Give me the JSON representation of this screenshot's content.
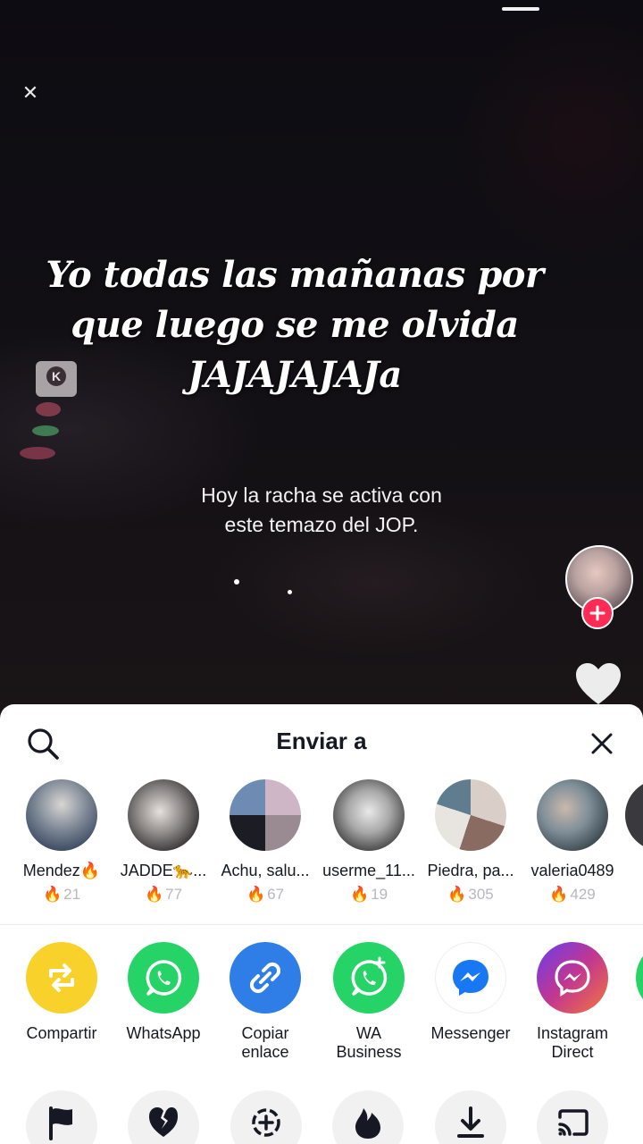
{
  "video": {
    "caption_lines": [
      "Yo todas las mañanas por",
      "que luego se me olvida",
      "JAJAJAJAJa"
    ],
    "subcaption_lines": [
      "Hoy la racha se activa con",
      "este temazo del JOP."
    ]
  },
  "share_sheet": {
    "title": "Enviar a",
    "contacts": [
      {
        "name": "Mendez🔥",
        "streak": "21"
      },
      {
        "name": "JADDE🐆...",
        "streak": "77"
      },
      {
        "name": "Achu, salu...",
        "streak": "67"
      },
      {
        "name": "userme_11...",
        "streak": "19"
      },
      {
        "name": "Piedra, pa...",
        "streak": "305"
      },
      {
        "name": "valeria0489",
        "streak": "429"
      }
    ],
    "apps": [
      {
        "label": "Compartir",
        "icon": "repost-icon",
        "color": "#f8d22a"
      },
      {
        "label": "WhatsApp",
        "icon": "whatsapp-icon",
        "color": "#25d366"
      },
      {
        "label": "Copiar\nenlace",
        "icon": "link-icon",
        "color": "#2f7ee8"
      },
      {
        "label": "WA\nBusiness",
        "icon": "whatsapp-business-icon",
        "color": "#25d366"
      },
      {
        "label": "Messenger",
        "icon": "messenger-icon",
        "color": "#ffffff"
      },
      {
        "label": "Instagram\nDirect",
        "icon": "instagram-direct-icon",
        "color": "#c2378f"
      }
    ],
    "tools": [
      "flag-icon",
      "broken-heart-icon",
      "duet-icon",
      "flame-icon",
      "download-icon",
      "cast-icon"
    ]
  }
}
